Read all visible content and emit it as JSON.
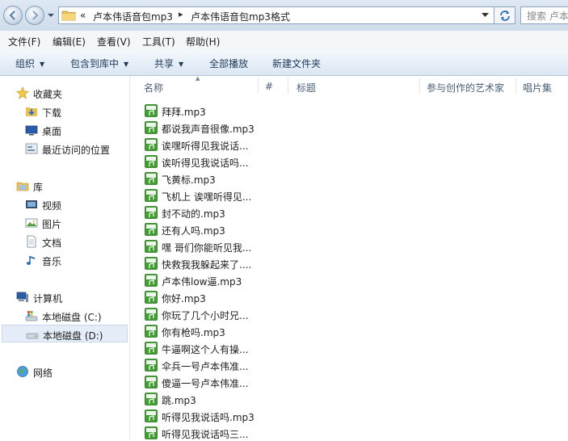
{
  "address": {
    "overflow": "«",
    "separator": "▸",
    "segments": [
      "卢本伟语音包mp3",
      "卢本伟语音包mp3格式"
    ],
    "search_placeholder": "搜索 卢本"
  },
  "menu": [
    "文件(F)",
    "编辑(E)",
    "查看(V)",
    "工具(T)",
    "帮助(H)"
  ],
  "commands": {
    "organize": "组织",
    "include": "包含到库中",
    "share": "共享",
    "play_all": "全部播放",
    "new_folder": "新建文件夹"
  },
  "nav": {
    "favorites": "收藏夹",
    "downloads": "下载",
    "desktop": "桌面",
    "recent": "最近访问的位置",
    "libraries": "库",
    "videos": "视频",
    "pictures": "图片",
    "documents": "文档",
    "music": "音乐",
    "computer": "计算机",
    "drive_c": "本地磁盘 (C:)",
    "drive_d": "本地磁盘 (D:)",
    "network": "网络"
  },
  "columns": [
    "名称",
    "#",
    "标题",
    "参与创作的艺术家",
    "唱片集"
  ],
  "files": [
    "拜拜.mp3",
    "都说我声音很像.mp3",
    "诶嘿听得见我说话...",
    "诶听得见我说话吗...",
    "飞黄标.mp3",
    "飞机上 诶嘿听得见...",
    "封不动的.mp3",
    "还有人吗.mp3",
    "嘿 哥们你能听见我...",
    "快救我我躲起来了....",
    "卢本伟low逼.mp3",
    "你好.mp3",
    "你玩了几个小时兄...",
    "你有枪吗.mp3",
    "牛逼啊这个人有操...",
    "伞兵一号卢本伟准...",
    "傻逼一号卢本伟准...",
    "跳.mp3",
    "听得见我说话吗.mp3",
    "听得见我说话吗三..."
  ],
  "colors": {
    "accent": "#1e395b",
    "mp3_icon": "#3f9e2f",
    "selection": "#e5eef8"
  }
}
